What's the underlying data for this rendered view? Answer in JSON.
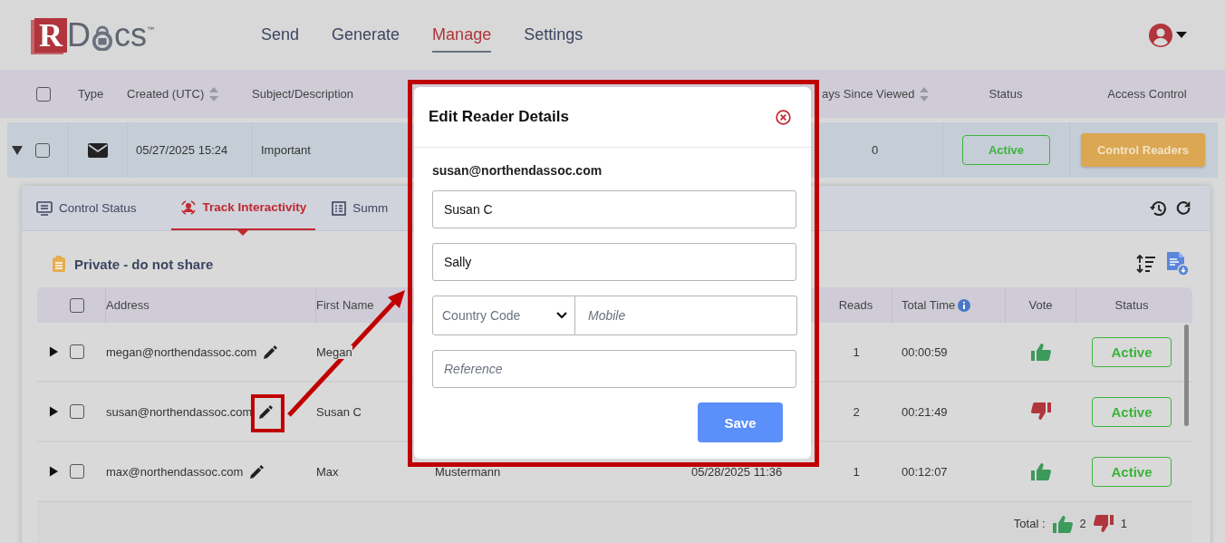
{
  "logo": {
    "initial": "R",
    "part_before": "D",
    "part_after": "cs",
    "mark": "™"
  },
  "nav": [
    {
      "label": "Send",
      "selected": false
    },
    {
      "label": "Generate",
      "selected": false
    },
    {
      "label": "Manage",
      "selected": true
    },
    {
      "label": "Settings",
      "selected": false
    }
  ],
  "documents_table": {
    "select_all_checked": false,
    "columns": [
      "Type",
      "Created (UTC)",
      "Subject/Description",
      "ays Since Viewed",
      "Status",
      "Access Control"
    ],
    "rows": [
      {
        "expanded": true,
        "checked": false,
        "created": "05/27/2025 15:24",
        "subject": "Important",
        "days_since_viewed": "0",
        "status": "Active",
        "action": "Control Readers"
      }
    ]
  },
  "detail": {
    "tabs": [
      {
        "label": "Control Status",
        "selected": false
      },
      {
        "label": "Track Interactivity",
        "selected": true
      },
      {
        "label": "Summ",
        "selected": false
      }
    ],
    "note": "Private - do not share",
    "readers_table": {
      "select_all_checked": false,
      "columns": [
        "Address",
        "First Name",
        "Reads",
        "Total Time",
        "Vote",
        "Status"
      ],
      "rows": [
        {
          "expanded": false,
          "checked": false,
          "address": "megan@northendassoc.com",
          "first_name": "Megan",
          "reads": "1",
          "total_time": "00:00:59",
          "vote_up": true,
          "status": "Active"
        },
        {
          "expanded": false,
          "checked": false,
          "address": "susan@northendassoc.com",
          "first_name": "Susan C",
          "reads": "2",
          "total_time": "00:21:49",
          "vote_up": false,
          "status": "Active"
        },
        {
          "expanded": false,
          "checked": false,
          "address": "max@northendassoc.com",
          "first_name": "Max",
          "last_name": "Mustermann",
          "column_5": "05/28/2025 11:36",
          "reads": "1",
          "total_time": "00:12:07",
          "vote_up": true,
          "status": "Active"
        }
      ],
      "footer": {
        "label": "Total :",
        "up_count": "2",
        "down_count": "1"
      }
    }
  },
  "modal": {
    "title": "Edit Reader Details",
    "email": "susan@northendassoc.com",
    "fields": [
      {
        "kind": "text",
        "value": "Susan C"
      },
      {
        "kind": "text",
        "value": "Sally"
      },
      {
        "kind": "phone",
        "select_placeholder": "Country Code",
        "placeholder": "Mobile"
      },
      {
        "kind": "text",
        "placeholder": "Reference"
      }
    ],
    "save": "Save"
  }
}
